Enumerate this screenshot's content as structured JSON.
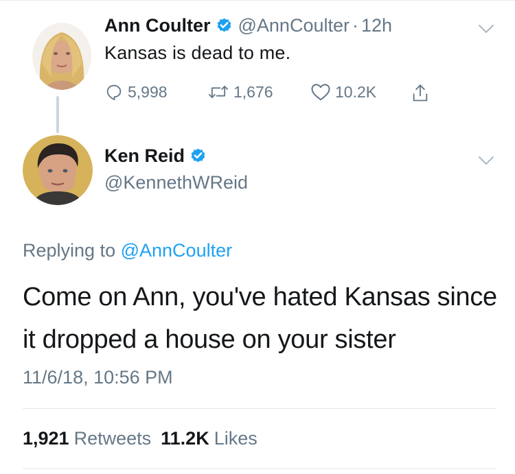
{
  "parent_tweet": {
    "author_name": "Ann Coulter",
    "handle": "@AnnCoulter",
    "separator": "·",
    "time": "12h",
    "text": "Kansas is dead to me.",
    "replies": "5,998",
    "retweets": "1,676",
    "likes": "10.2K",
    "icons": [
      "reply-icon",
      "retweet-icon",
      "like-icon",
      "share-icon",
      "verified-badge-icon",
      "chevron-down-icon"
    ]
  },
  "reply_tweet": {
    "author_name": "Ken Reid",
    "handle": "@KennethWReid",
    "replying_prefix": "Replying to",
    "replying_to": "@AnnCoulter",
    "text": "Come on Ann, you've hated Kansas since it dropped a house on your sister",
    "timestamp": "11/6/18, 10:56 PM",
    "retweet_count": "1,921",
    "retweet_label": "Retweets",
    "like_count": "11.2K",
    "like_label": "Likes"
  },
  "colors": {
    "text_primary": "#14171a",
    "text_secondary": "#657786",
    "link": "#1da1f2",
    "verified": "#1da1f2",
    "divider": "#e1e8ed",
    "thread_line": "#ccd6dd"
  }
}
